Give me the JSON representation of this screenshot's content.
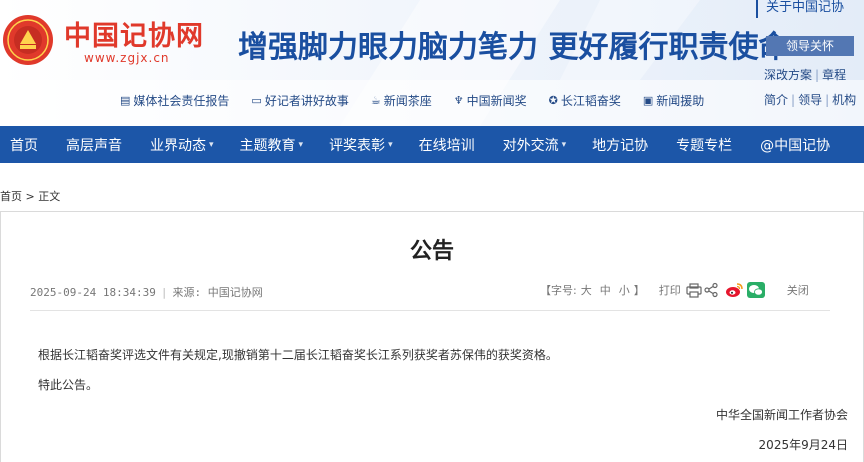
{
  "header": {
    "logo_title": "中国记协网",
    "logo_url": "www.zgjx.cn",
    "slogan": "增强脚力眼力脑力笔力 更好履行职责使命",
    "feature_links": [
      {
        "label": "媒体社会责任报告",
        "icon": "report-icon"
      },
      {
        "label": "好记者讲好故事",
        "icon": "speech-icon"
      },
      {
        "label": "新闻茶座",
        "icon": "teacup-icon"
      },
      {
        "label": "中国新闻奖",
        "icon": "trophy-icon"
      },
      {
        "label": "长江韬奋奖",
        "icon": "medal-icon"
      },
      {
        "label": "新闻援助",
        "icon": "aid-icon"
      }
    ],
    "about_link": "关于中国记协",
    "leader_button": "领导关怀",
    "side_links_row1": [
      "深改方案",
      "章程"
    ],
    "side_links_row2": [
      "简介",
      "领导",
      "机构"
    ]
  },
  "nav": {
    "items": [
      {
        "label": "首页",
        "dropdown": false
      },
      {
        "label": "高层声音",
        "dropdown": false
      },
      {
        "label": "业界动态",
        "dropdown": true
      },
      {
        "label": "主题教育",
        "dropdown": true
      },
      {
        "label": "评奖表彰",
        "dropdown": true
      },
      {
        "label": "在线培训",
        "dropdown": false
      },
      {
        "label": "对外交流",
        "dropdown": true
      },
      {
        "label": "地方记协",
        "dropdown": false
      },
      {
        "label": "专题专栏",
        "dropdown": false
      },
      {
        "label": "@中国记协",
        "dropdown": false
      }
    ]
  },
  "breadcrumb": {
    "home": "首页",
    "separator": ">",
    "current": "正文"
  },
  "article": {
    "title": "公告",
    "datetime": "2025-09-24 18:34:39",
    "source_label": "来源:",
    "source_value": "中国记协网",
    "font_size_prefix": "【字号:",
    "font_sizes": [
      "大",
      "中",
      "小"
    ],
    "font_size_suffix": "】",
    "print_label": "打印",
    "close_label": "关闭",
    "paragraphs": [
      "根据长江韬奋奖评选文件有关规定,现撤销第十二届长江韬奋奖长江系列获奖者苏保伟的获奖资格。",
      "特此公告。"
    ],
    "signature_org": "中华全国新闻工作者协会",
    "signature_date": "2025年9月24日"
  },
  "colors": {
    "brand_red": "#e0392b",
    "brand_blue": "#1a4fa0",
    "nav_blue": "#1c56a8"
  }
}
